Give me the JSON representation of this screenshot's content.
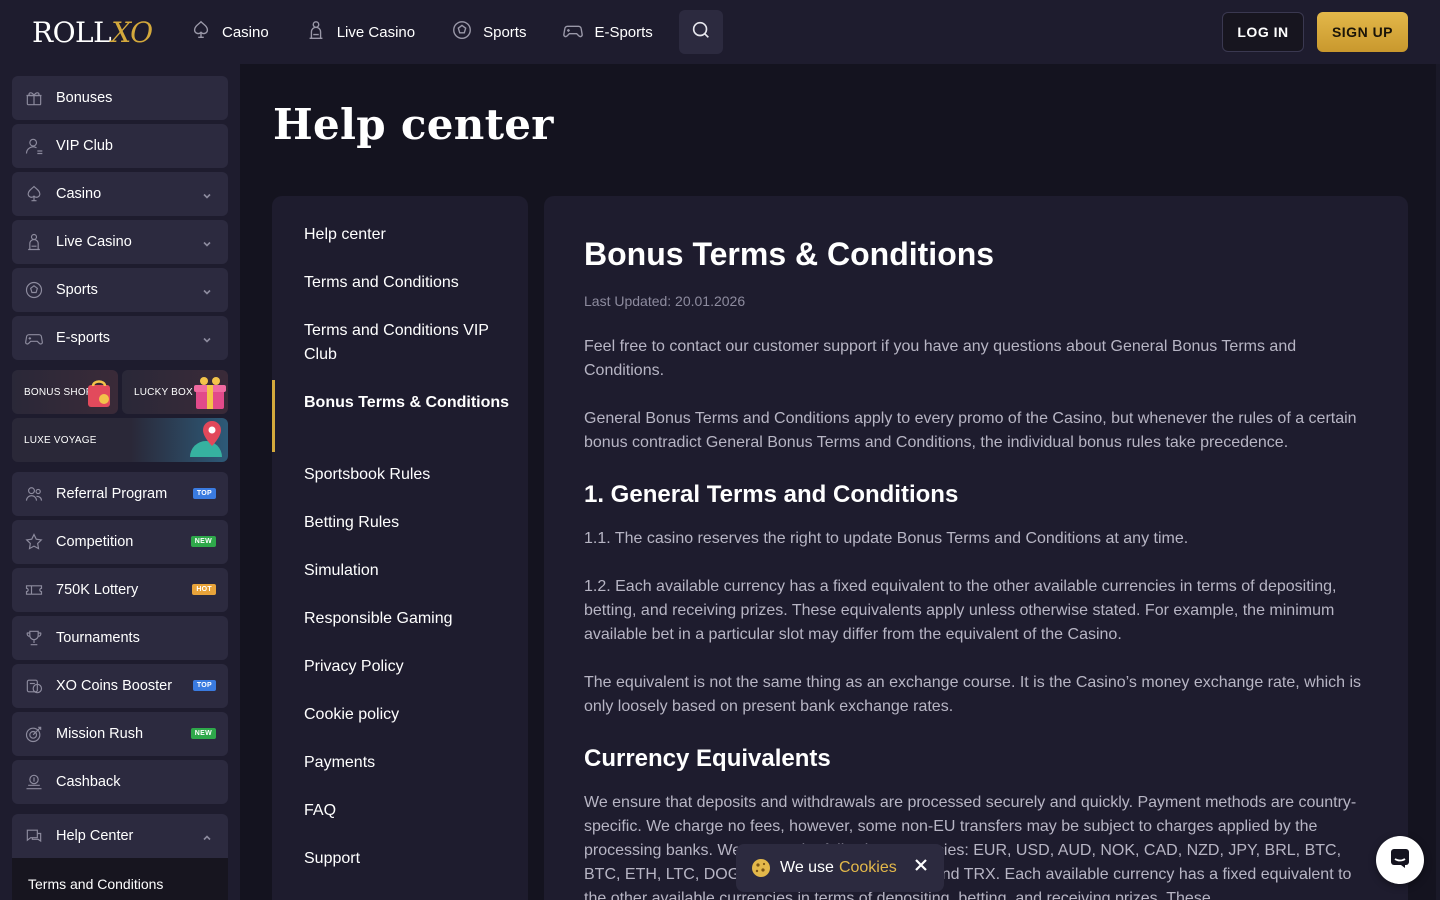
{
  "header": {
    "logo_text_1": "ROLL",
    "logo_text_2": "XO",
    "nav": [
      {
        "label": "Casino",
        "icon": "casino-icon"
      },
      {
        "label": "Live Casino",
        "icon": "live-casino-icon"
      },
      {
        "label": "Sports",
        "icon": "sports-ball-icon"
      },
      {
        "label": "E-Sports",
        "icon": "gamepad-icon"
      }
    ],
    "login_label": "LOG IN",
    "signup_label": "SIGN UP"
  },
  "sidebar": {
    "items": [
      {
        "label": "Bonuses",
        "icon": "gift-icon"
      },
      {
        "label": "VIP Club",
        "icon": "vip-user-icon"
      },
      {
        "label": "Casino",
        "icon": "casino-icon"
      },
      {
        "label": "Live Casino",
        "icon": "live-casino-icon"
      },
      {
        "label": "Sports",
        "icon": "sports-ball-icon"
      },
      {
        "label": "E-sports",
        "icon": "gamepad-icon"
      }
    ],
    "promos": {
      "bonus_shop": "BONUS SHOP",
      "lucky_box": "LUCKY BOX",
      "luxe_voyage": "LUXE VOYAGE"
    },
    "items2": [
      {
        "label": "Referral Program",
        "badge": "TOP",
        "icon": "referral-icon"
      },
      {
        "label": "Competition",
        "badge": "NEW",
        "icon": "star-icon"
      },
      {
        "label": "750K Lottery",
        "badge": "HOT",
        "icon": "ticket-icon"
      },
      {
        "label": "Tournaments",
        "badge": "",
        "icon": "trophy-icon"
      },
      {
        "label": "XO Coins Booster",
        "badge": "TOP",
        "icon": "coins-icon"
      },
      {
        "label": "Mission Rush",
        "badge": "NEW",
        "icon": "target-icon"
      },
      {
        "label": "Cashback",
        "badge": "",
        "icon": "cashback-icon"
      }
    ],
    "help": {
      "label": "Help Center",
      "sub_item": "Terms and Conditions"
    }
  },
  "main": {
    "page_title": "Help center",
    "help_nav": [
      "Help center",
      "Terms and Conditions",
      "Terms and Conditions VIP Club",
      "Bonus Terms & Conditions",
      "Sportsbook Rules",
      "Betting Rules",
      "Simulation",
      "Responsible Gaming",
      "Privacy Policy",
      "Cookie policy",
      "Payments",
      "FAQ",
      "Support"
    ],
    "active_nav": "Bonus Terms & Conditions",
    "article": {
      "title": "Bonus Terms & Conditions",
      "updated": "Last Updated: 20.01.2026",
      "p1": "Feel free to contact our customer support if you have any questions about General Bonus Terms and Conditions.",
      "p2": "General Bonus Terms and Conditions apply to every promo of the Casino, but whenever the rules of a certain bonus contradict General Bonus Terms and Conditions, the individual bonus rules take precedence.",
      "h1": "1. General Terms and Conditions",
      "p3": "1.1. The casino reserves the right to update Bonus Terms and Conditions at any time.",
      "p4": "1.2. Each available currency has a fixed equivalent to the other available currencies in terms of depositing, betting, and receiving prizes. These equivalents apply unless otherwise stated. For example, the minimum available bet in a particular slot may differ from the equivalent of the Casino.",
      "p5": "The equivalent is not the same thing as an exchange course. It is the Casino’s money exchange rate, which is only loosely based on present bank exchange rates.",
      "h2": "Currency Equivalents",
      "p6": "We ensure that deposits and withdrawals are processed securely and quickly. Payment methods are country-specific. We charge no fees, however, some non-EU transfers may be subject to charges applied by the processing banks. We accept the following currencies: EUR, USD, AUD, NOK, CAD, NZD, JPY, BRL, BTC, BTC, ETH, LTC, DOGE, USDT, XRP, BNB, ADA, and TRX. Each available currency has a fixed equivalent to the other available currencies in terms of depositing, betting, and receiving prizes. These"
    }
  },
  "cookie": {
    "text": "We use",
    "link": "Cookies"
  },
  "colors": {
    "accent": "#d4a93c",
    "background": "#14131f",
    "panel": "#1e1c2e",
    "item": "#2c2a3f"
  }
}
